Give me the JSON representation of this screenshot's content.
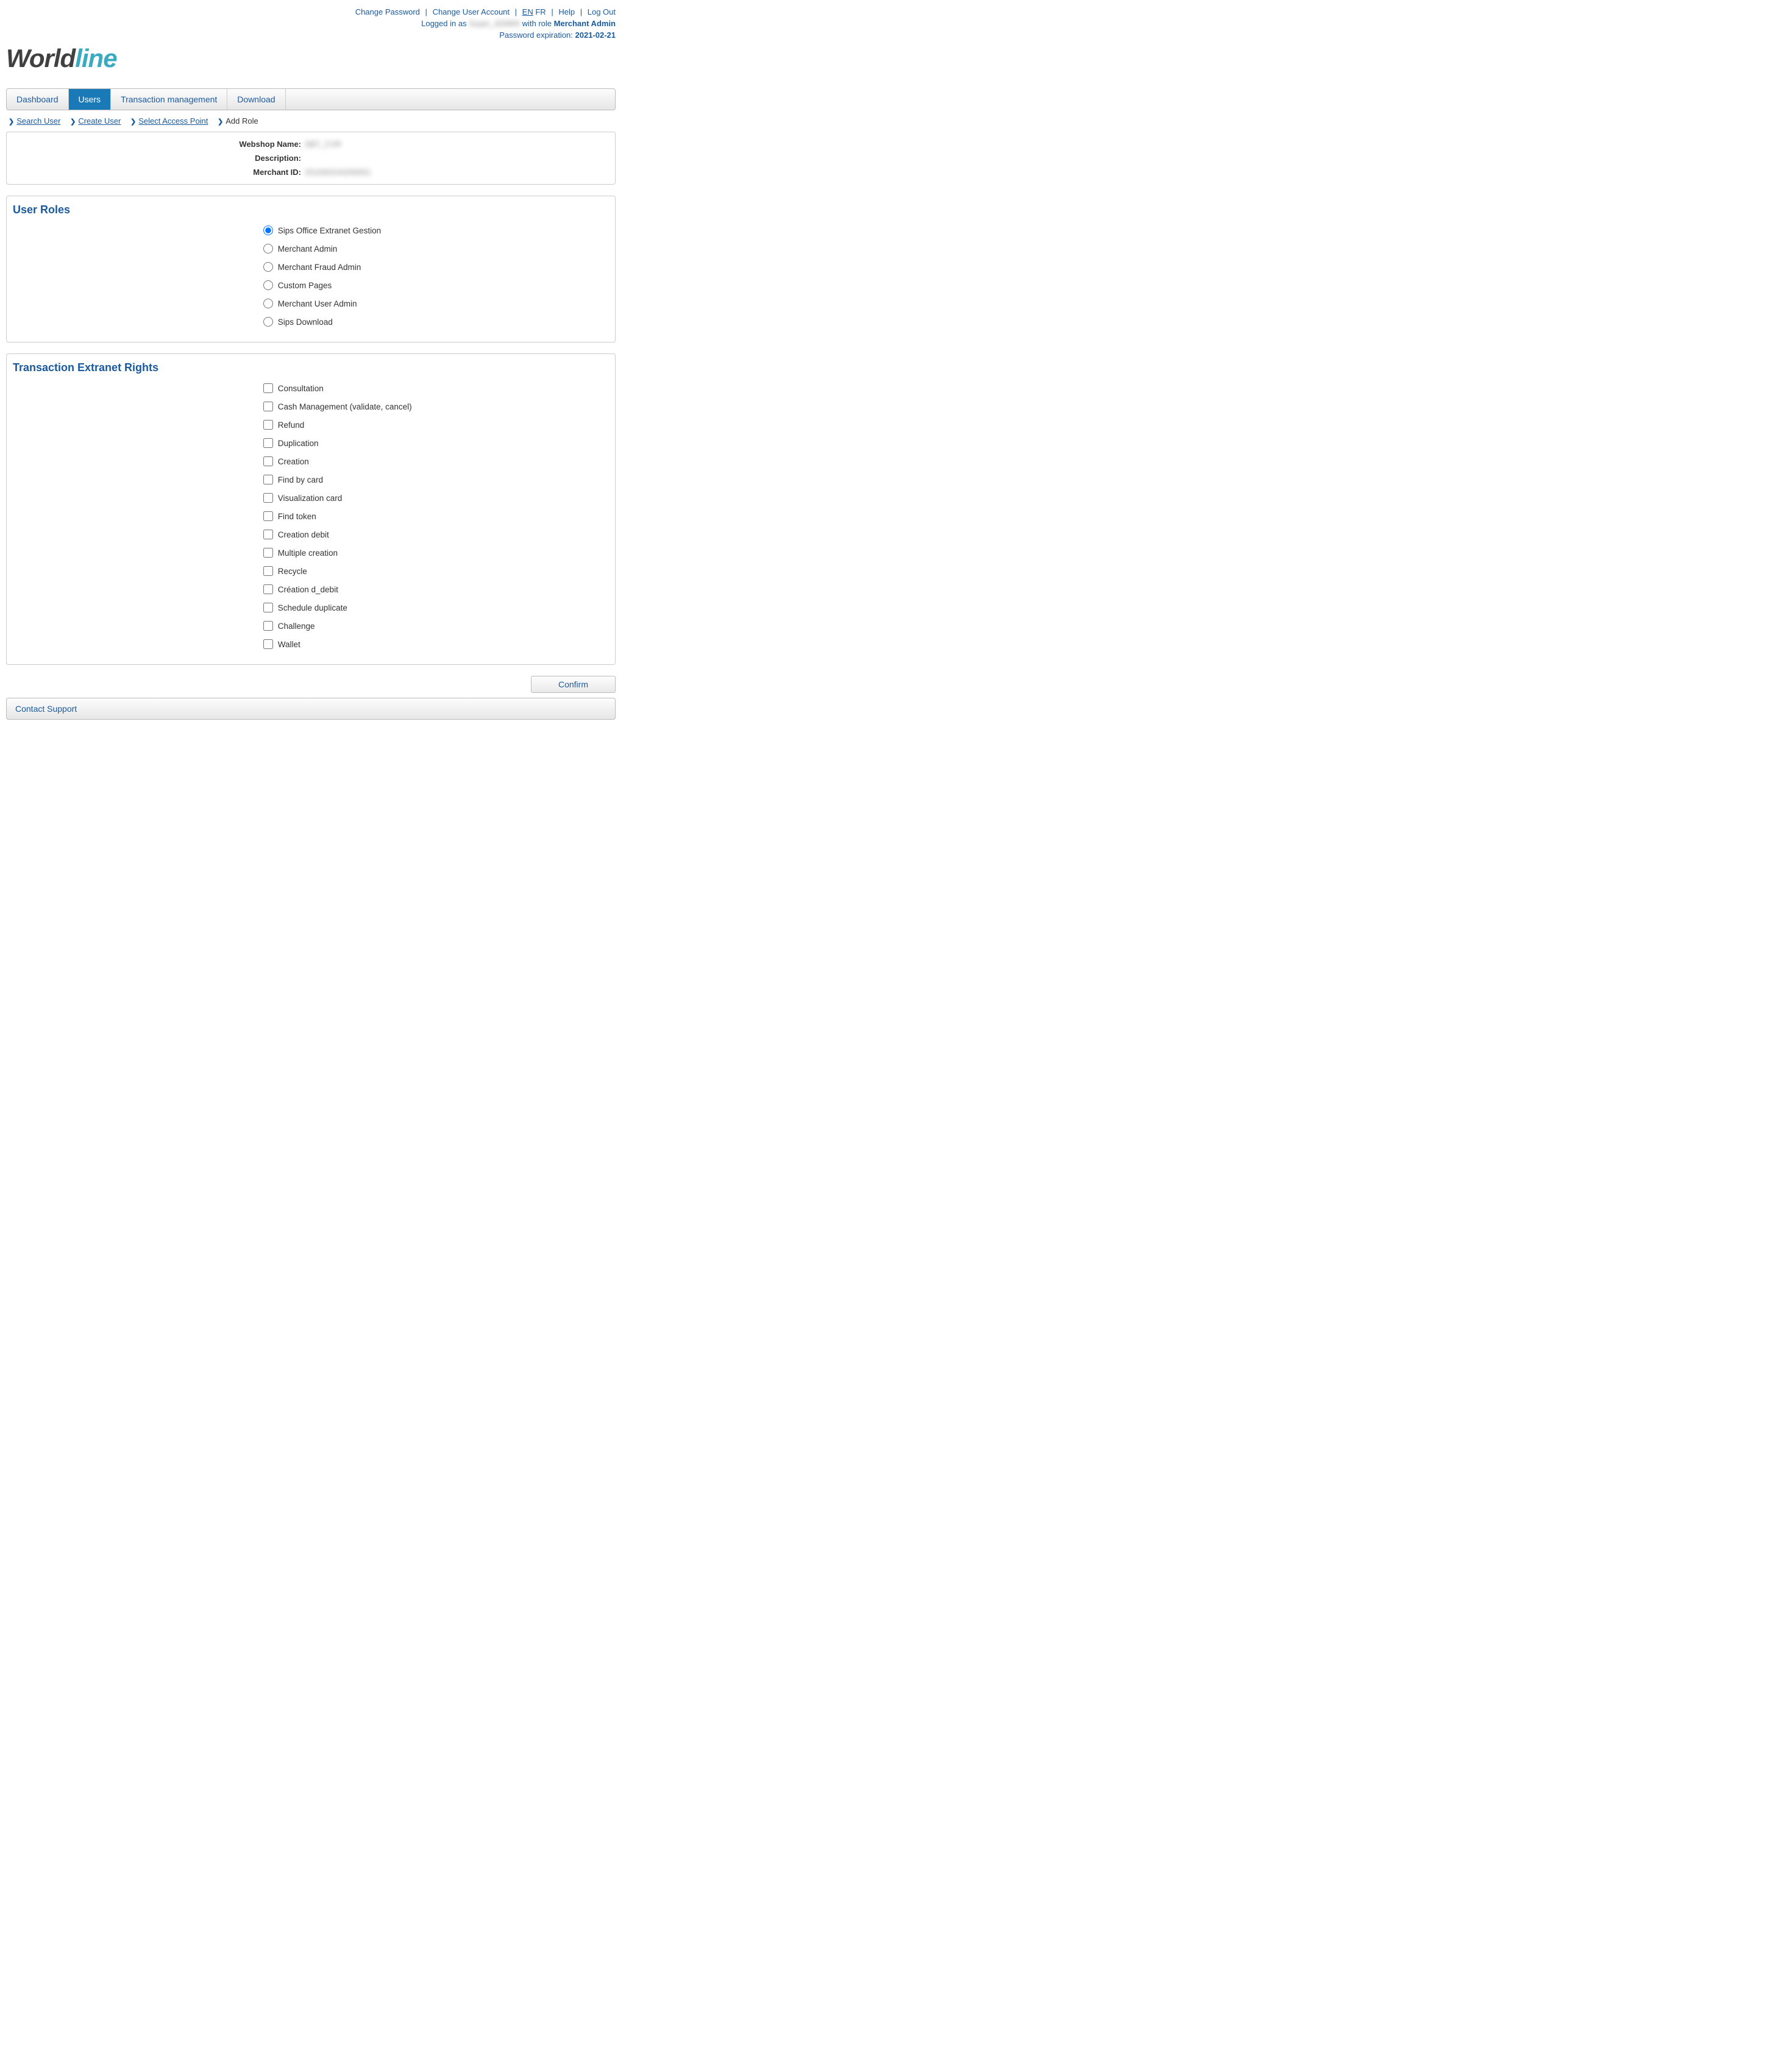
{
  "header": {
    "links": {
      "change_password": "Change Password",
      "change_account": "Change User Account",
      "lang_en": "EN",
      "lang_fr": "FR",
      "help": "Help",
      "logout": "Log Out"
    },
    "logged_in_prefix": "Logged in as ",
    "logged_in_user": "Super_ADMIN",
    "logged_in_mid": " with role ",
    "role": "Merchant Admin",
    "pwd_exp_label": "Password expiration: ",
    "pwd_exp_date": "2021-02-21"
  },
  "tabs": {
    "dashboard": "Dashboard",
    "users": "Users",
    "tx_mgmt": "Transaction management",
    "download": "Download"
  },
  "breadcrumb": {
    "search_user": "Search User",
    "create_user": "Create User",
    "select_ap": "Select Access Point",
    "add_role": "Add Role"
  },
  "info": {
    "webshop_label": "Webshop Name:",
    "webshop_value": "SBT_CVR",
    "desc_label": "Description:",
    "desc_value": "",
    "merchant_label": "Merchant ID:",
    "merchant_value": "201000243200001"
  },
  "sections": {
    "user_roles_title": "User Roles",
    "tx_rights_title": "Transaction Extranet Rights"
  },
  "roles": [
    {
      "label": "Sips Office Extranet Gestion",
      "checked": true
    },
    {
      "label": "Merchant Admin",
      "checked": false
    },
    {
      "label": "Merchant Fraud Admin",
      "checked": false
    },
    {
      "label": "Custom Pages",
      "checked": false
    },
    {
      "label": "Merchant User Admin",
      "checked": false
    },
    {
      "label": "Sips Download",
      "checked": false
    }
  ],
  "rights": [
    {
      "label": "Consultation"
    },
    {
      "label": "Cash Management (validate, cancel)"
    },
    {
      "label": "Refund"
    },
    {
      "label": "Duplication"
    },
    {
      "label": "Creation"
    },
    {
      "label": "Find by card"
    },
    {
      "label": "Visualization card"
    },
    {
      "label": "Find token"
    },
    {
      "label": "Creation debit"
    },
    {
      "label": "Multiple creation"
    },
    {
      "label": "Recycle"
    },
    {
      "label": "Création d_debit"
    },
    {
      "label": "Schedule duplicate"
    },
    {
      "label": "Challenge"
    },
    {
      "label": "Wallet"
    }
  ],
  "buttons": {
    "confirm": "Confirm"
  },
  "footer": {
    "contact": "Contact Support"
  }
}
